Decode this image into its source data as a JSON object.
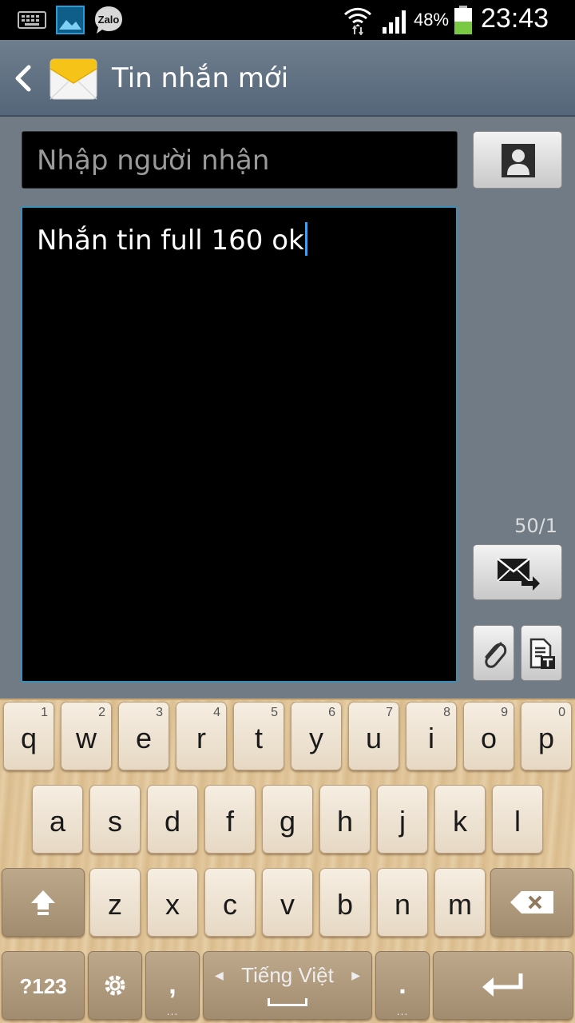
{
  "status_bar": {
    "notification_icons": [
      "keyboard-icon",
      "gallery-icon",
      "zalo-icon"
    ],
    "zalo_label": "Zalo",
    "battery_percent": "48%",
    "battery_level": 0.48,
    "time": "23:43"
  },
  "action_bar": {
    "title": "Tin nhắn mới",
    "back_icon": "chevron-left-icon",
    "app_icon": "envelope-icon"
  },
  "compose": {
    "recipient_placeholder": "Nhập người nhận",
    "message_text": "Nhắn tin full 160 ok",
    "counter": "50/1"
  },
  "keyboard": {
    "row1": [
      {
        "ch": "q",
        "num": "1"
      },
      {
        "ch": "w",
        "num": "2"
      },
      {
        "ch": "e",
        "num": "3"
      },
      {
        "ch": "r",
        "num": "4"
      },
      {
        "ch": "t",
        "num": "5"
      },
      {
        "ch": "y",
        "num": "6"
      },
      {
        "ch": "u",
        "num": "7"
      },
      {
        "ch": "i",
        "num": "8"
      },
      {
        "ch": "o",
        "num": "9"
      },
      {
        "ch": "p",
        "num": "0"
      }
    ],
    "row2": [
      "a",
      "s",
      "d",
      "f",
      "g",
      "h",
      "j",
      "k",
      "l"
    ],
    "row3": [
      "z",
      "x",
      "c",
      "v",
      "b",
      "n",
      "m"
    ],
    "symbols_label": "?123",
    "comma_label": ",",
    "period_label": ".",
    "language_label": "Tiếng Việt",
    "dots_label": "..."
  },
  "colors": {
    "accent": "#3a8fb7",
    "caret": "#3aa0ff",
    "battery_fill": "#7ac943"
  }
}
